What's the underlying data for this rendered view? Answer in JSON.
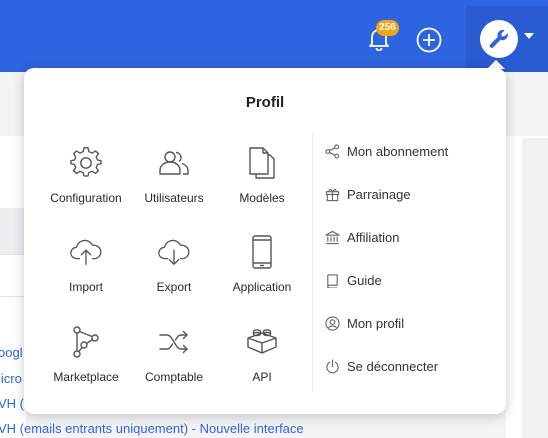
{
  "header": {
    "notification_count": "256",
    "icons": [
      "bell-icon",
      "plus-circle-icon",
      "wrench-icon",
      "caret-down-icon"
    ],
    "colors": {
      "bar": "#2f64e0",
      "badge": "#f0a617"
    }
  },
  "background": {
    "links": [
      "oogl",
      "licro",
      "VH (e",
      "VH (emails entrants uniquement) - Nouvelle interface"
    ]
  },
  "dropdown": {
    "title": "Profil",
    "grid": [
      {
        "label": "Configuration",
        "icon": "gear-icon"
      },
      {
        "label": "Utilisateurs",
        "icon": "users-icon"
      },
      {
        "label": "Modèles",
        "icon": "documents-icon"
      },
      {
        "label": "Import",
        "icon": "cloud-upload-icon"
      },
      {
        "label": "Export",
        "icon": "cloud-download-icon"
      },
      {
        "label": "Application",
        "icon": "mobile-phone-icon"
      },
      {
        "label": "Marketplace",
        "icon": "nodes-icon"
      },
      {
        "label": "Comptable",
        "icon": "shuffle-icon"
      },
      {
        "label": "API",
        "icon": "brick-icon"
      }
    ],
    "menu": [
      {
        "label": "Mon abonnement",
        "icon": "share-icon"
      },
      {
        "label": "Parrainage",
        "icon": "gift-icon"
      },
      {
        "label": "Affiliation",
        "icon": "bank-icon"
      },
      {
        "label": "Guide",
        "icon": "book-icon"
      },
      {
        "label": "Mon profil",
        "icon": "user-circle-icon"
      },
      {
        "label": "Se déconnecter",
        "icon": "power-icon"
      }
    ]
  }
}
